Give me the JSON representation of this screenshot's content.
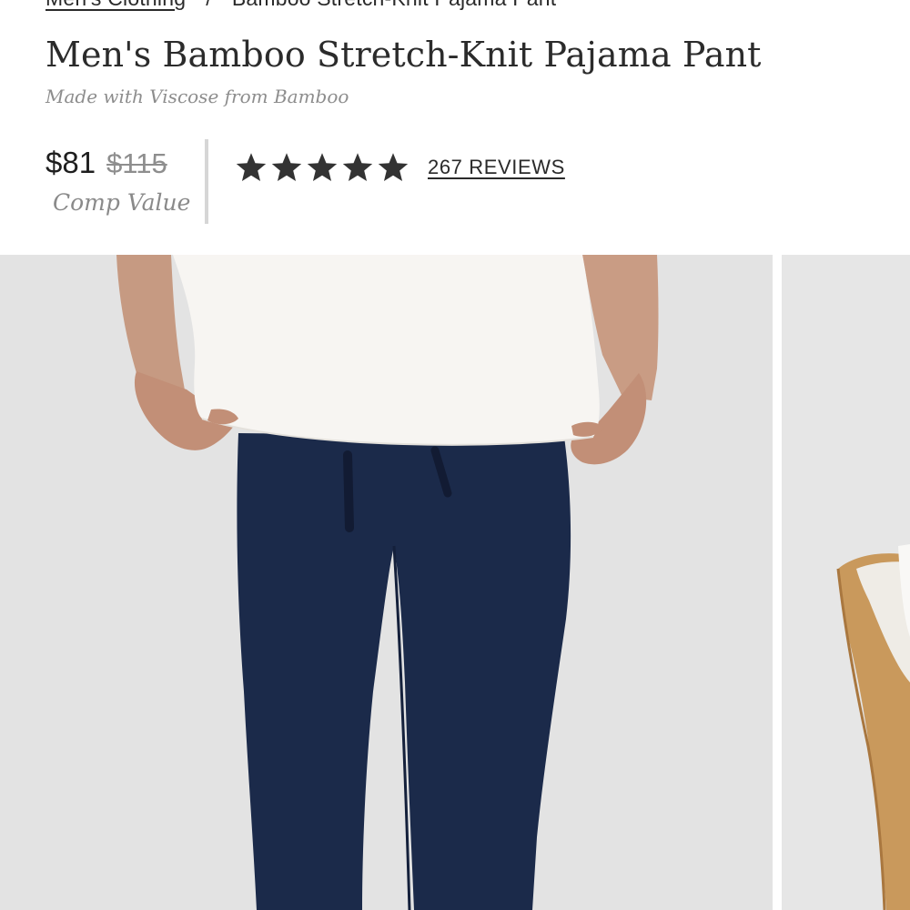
{
  "breadcrumb": {
    "parent": "Men's Clothing",
    "separator": "/",
    "current": "Bamboo Stretch-Knit Pajama Pant"
  },
  "product": {
    "title": "Men's Bamboo Stretch-Knit Pajama Pant",
    "subtitle": "Made with Viscose from Bamboo",
    "price": "$81",
    "compare_price": "$115",
    "compare_label": "Comp Value"
  },
  "rating": {
    "stars": 5,
    "reviews_label": "267 REVIEWS"
  },
  "colors": {
    "text": "#2b2b2b",
    "muted": "#8d8d8d",
    "star": "#333333",
    "pants_navy": "#1b2a4a",
    "photo_bg": "#e3e3e3"
  },
  "gallery": {
    "images": [
      {
        "icon": "product-photo-pajama-pant-front"
      },
      {
        "icon": "product-photo-chair-partial"
      }
    ]
  }
}
